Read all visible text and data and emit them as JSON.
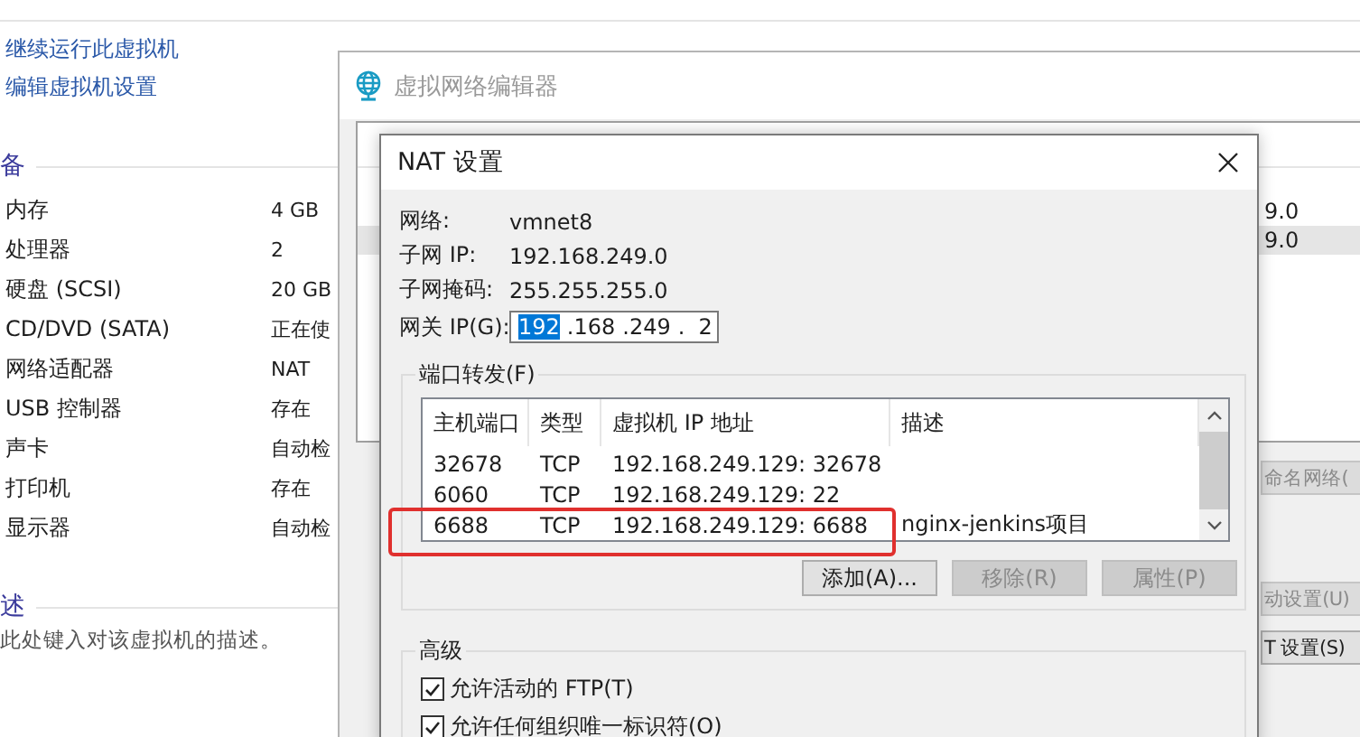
{
  "vm_panel": {
    "actions": [
      "继续运行此虚拟机",
      "编辑虚拟机设置"
    ],
    "devices_heading": "备",
    "devices": [
      {
        "name": "内存",
        "value": "4 GB"
      },
      {
        "name": "处理器",
        "value": "2"
      },
      {
        "name": "硬盘 (SCSI)",
        "value": "20 GB"
      },
      {
        "name": "CD/DVD (SATA)",
        "value": "正在使"
      },
      {
        "name": "网络适配器",
        "value": "NAT"
      },
      {
        "name": "USB 控制器",
        "value": "存在"
      },
      {
        "name": "声卡",
        "value": "自动检"
      },
      {
        "name": "打印机",
        "value": "存在"
      },
      {
        "name": "显示器",
        "value": "自动检"
      }
    ],
    "description_heading": "述",
    "description": "此处键入对该虚拟机的描述。"
  },
  "network_editor": {
    "title": "虚拟网络编辑器",
    "table_rows": [
      {
        "column_last": "9.0",
        "selected": false
      },
      {
        "column_last": "9.0",
        "selected": true
      }
    ],
    "buttons": [
      "命名网络(",
      "动设置(U)",
      "T 设置(S)"
    ]
  },
  "nat_dialog": {
    "title": "NAT 设置",
    "fields": [
      {
        "label": "网络:",
        "value": "vmnet8"
      },
      {
        "label": "子网 IP:",
        "value": "192.168.249.0"
      },
      {
        "label": "子网掩码:",
        "value": "255.255.255.0"
      }
    ],
    "gateway": {
      "label": "网关 IP(G):",
      "parts": [
        {
          "text": "192",
          "selected": true
        },
        {
          "text": ".168",
          "selected": false
        },
        {
          "text": ".249",
          "selected": false
        },
        {
          "text": ".  2",
          "selected": false
        }
      ]
    },
    "port_forwarding": {
      "title": "端口转发(F)",
      "columns": [
        "主机端口",
        "类型",
        "虚拟机 IP 地址",
        "描述"
      ],
      "rows": [
        {
          "host_port": "32678",
          "type": "TCP",
          "vm_address": "192.168.249.129: 32678",
          "description": "",
          "annotated": false
        },
        {
          "host_port": "6060",
          "type": "TCP",
          "vm_address": "192.168.249.129: 22",
          "description": "",
          "annotated": false
        },
        {
          "host_port": "6688",
          "type": "TCP",
          "vm_address": "192.168.249.129: 6688",
          "description": "nginx-jenkins项目",
          "annotated": true
        }
      ],
      "buttons": [
        {
          "label": "添加(A)...",
          "disabled": false
        },
        {
          "label": "移除(R)",
          "disabled": true
        },
        {
          "label": "属性(P)",
          "disabled": true
        }
      ]
    },
    "advanced": {
      "title": "高级",
      "options": [
        {
          "label": "允许活动的 FTP(T)",
          "checked": true
        },
        {
          "label": "允许任何组织唯一标识符(O)",
          "checked": true
        }
      ]
    }
  }
}
